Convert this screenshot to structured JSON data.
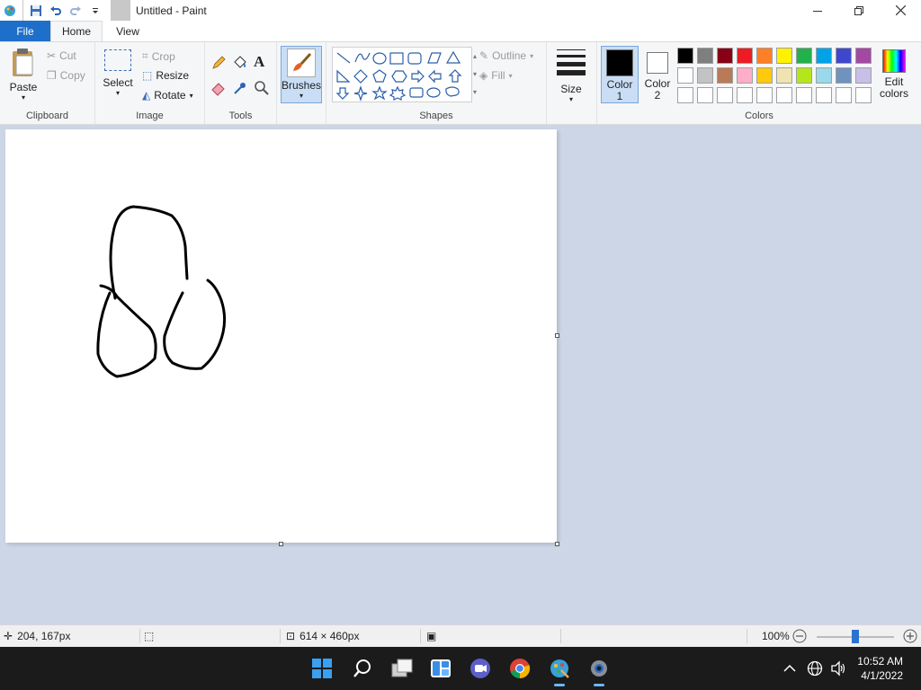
{
  "window": {
    "title": "Untitled - Paint"
  },
  "tabs": [
    "File",
    "Home",
    "View"
  ],
  "clipboard": {
    "paste": "Paste",
    "cut": "Cut",
    "copy": "Copy",
    "label": "Clipboard"
  },
  "image": {
    "select": "Select",
    "crop": "Crop",
    "resize": "Resize",
    "rotate": "Rotate",
    "label": "Image"
  },
  "tools": {
    "label": "Tools",
    "text_tool": "A"
  },
  "brushes": {
    "label": "Brushes"
  },
  "shapes": {
    "outline": "Outline",
    "fill": "Fill",
    "label": "Shapes"
  },
  "size": {
    "label": "Size"
  },
  "colors": {
    "color1": "Color 1",
    "color2": "Color 2",
    "edit": "Edit colors",
    "label": "Colors",
    "color1_value": "#000000",
    "color2_value": "#ffffff",
    "palette_row1": [
      "#000000",
      "#7f7f7f",
      "#880015",
      "#ed1c24",
      "#ff7f27",
      "#fff200",
      "#22b14c",
      "#00a2e8",
      "#3f48cc",
      "#a349a4"
    ],
    "palette_row2": [
      "#ffffff",
      "#c3c3c3",
      "#b97a57",
      "#ffaec9",
      "#ffc90e",
      "#efe4b0",
      "#b5e61d",
      "#99d9ea",
      "#7092be",
      "#c8bfe7"
    ],
    "palette_row3": [
      "#ffffff",
      "#ffffff",
      "#ffffff",
      "#ffffff",
      "#ffffff",
      "#ffffff",
      "#ffffff",
      "#ffffff",
      "#ffffff",
      "#ffffff"
    ]
  },
  "status": {
    "cursor": "204, 167px",
    "canvas_size": "614 × 460px",
    "zoom": "100%",
    "zoom_level": 0.5
  },
  "taskbar": {
    "time": "10:52 AM",
    "date": "4/1/2022"
  }
}
